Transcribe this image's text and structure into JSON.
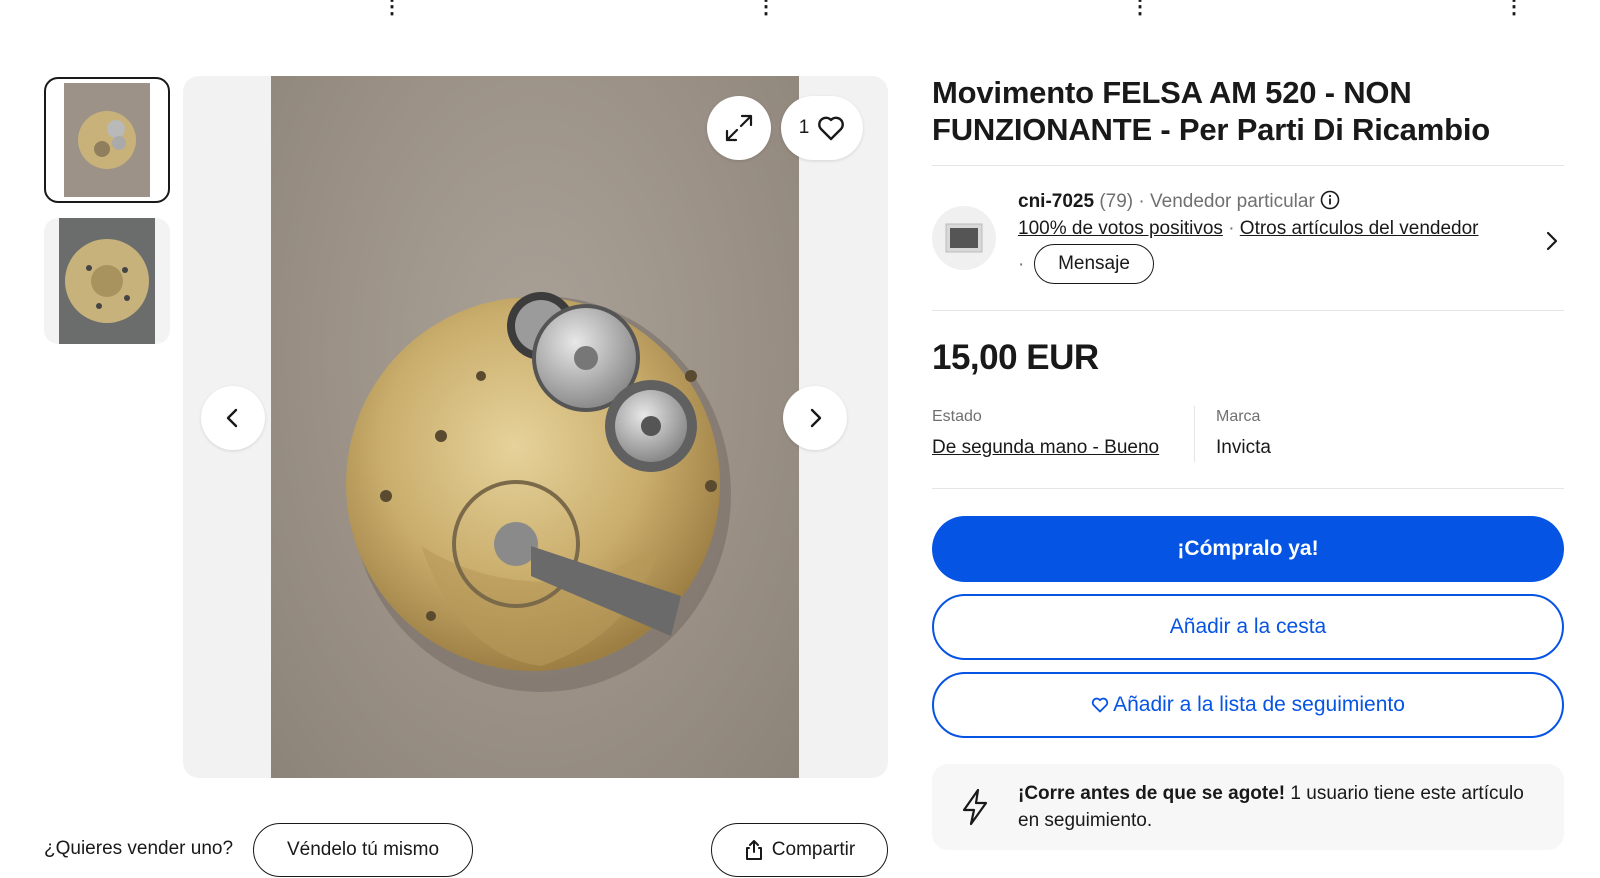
{
  "title": "Movimento FELSA AM 520 - NON FUNZIONANTE - Per Parti Di Ricambio",
  "gallery": {
    "watch_count": "1"
  },
  "seller": {
    "name": "cni-7025",
    "score": "(79)",
    "separator": "·",
    "type": "Vendedor particular",
    "feedback": "100% de votos positivos",
    "other_items": "Otros artículos del vendedor",
    "message_label": "Mensaje"
  },
  "price": "15,00 EUR",
  "attributes": [
    {
      "label": "Estado",
      "value": "De segunda mano - Bueno"
    },
    {
      "label": "Marca",
      "value": "Invicta"
    }
  ],
  "actions": {
    "buy_now": "¡Cómpralo ya!",
    "add_cart": "Añadir a la cesta",
    "watchlist": "Añadir a la lista de seguimiento"
  },
  "notice": {
    "bold": "¡Corre antes de que se agote!",
    "text": " 1 usuario tiene este artículo en seguimiento."
  },
  "sell": {
    "question": "¿Quieres vender uno?",
    "button": "Véndelo tú mismo"
  },
  "share_label": "Compartir",
  "colors": {
    "primary": "#0654e4",
    "text": "#191919",
    "muted": "#707070"
  }
}
